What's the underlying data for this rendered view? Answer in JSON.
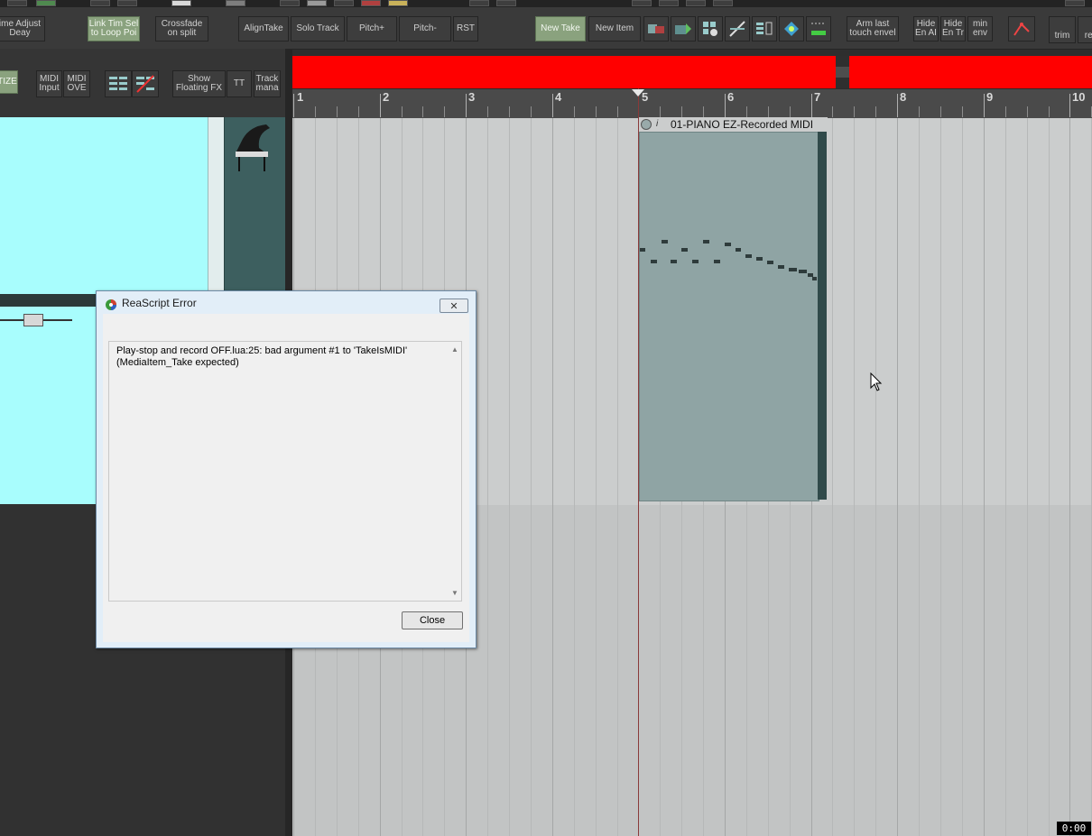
{
  "toolbar": {
    "time_adjust": "ime Adjust\nDeay",
    "link_tim_sel": "Link Tim Sel\nto Loop Poi",
    "crossfade": "Crossfade\non split",
    "align_take": "AlignTake",
    "solo_track": "Solo Track",
    "pitch_plus": "Pitch+",
    "pitch_minus": "Pitch-",
    "rst": "RST",
    "new_take": "New Take",
    "new_item": "New Item",
    "arm_last": "Arm last\ntouch envel",
    "hide_en_ai": "Hide\nEn AI",
    "hide_en_tr": "Hide\nEn Tr",
    "min_env": "min\nenv",
    "trim": "trim",
    "rea": "rea"
  },
  "toolbar2": {
    "quantize": "TIZE",
    "midi_input": "MIDI\nInput",
    "midi_ove": "MIDI\nOVE",
    "show_floating_fx": "Show\nFloating FX",
    "tt": "TT",
    "track_mana": "Track\nmana"
  },
  "ruler": {
    "bars": [
      "1",
      "2",
      "3",
      "4",
      "5",
      "6",
      "7",
      "8",
      "9",
      "10"
    ]
  },
  "item": {
    "name": "01-PIANO EZ-Recorded MIDI",
    "info_glyph": "i"
  },
  "dialog": {
    "title": "ReaScript Error",
    "message_line1": "Play-stop and record OFF.lua:25: bad argument #1 to 'TakeIsMIDI'",
    "message_line2": "(MediaItem_Take expected)",
    "close_label": "Close",
    "close_x": "✕"
  },
  "status": {
    "timecode": "0:00"
  },
  "colors": {
    "region": "#ff0000",
    "track_selected": "#a8fdfd",
    "item_body": "#8fa4a4",
    "toggle_on": "#8aa27e"
  }
}
